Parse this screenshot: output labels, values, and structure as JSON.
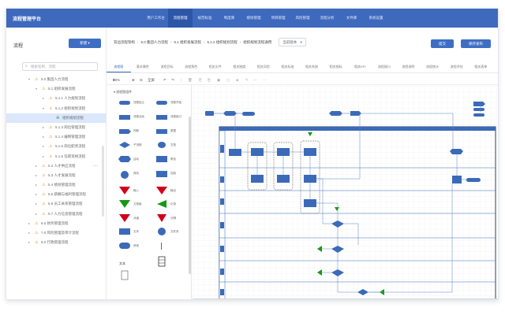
{
  "app": {
    "title": "流程管理平台"
  },
  "topnav": {
    "items": [
      "用户工作台",
      "流程管理",
      "规范标准",
      "制度库",
      "绩效管理",
      "项目管理",
      "风险管理",
      "流程分析",
      "文件库",
      "系统设置"
    ],
    "active_index": 1
  },
  "sidebar": {
    "title": "流程",
    "new_button": "新建",
    "search_placeholder": "搜索名称、流程",
    "tree": [
      {
        "label": "5.0 集团人力流程",
        "level": 1,
        "expanded": true
      },
      {
        "label": "5.1 组织发展流程",
        "level": 2,
        "expanded": true
      },
      {
        "label": "5.1.1 人力规划流程",
        "level": 3
      },
      {
        "label": "5.1.2 组织规划流程",
        "level": 3,
        "expanded": true
      },
      {
        "label": "组织规划流程",
        "level": 4,
        "selected": true
      },
      {
        "label": "5.1.3 岗位管理流程",
        "level": 3
      },
      {
        "label": "5.1.4 编制管理流程",
        "level": 3
      },
      {
        "label": "5.1.5 岗位职责流程",
        "level": 3
      },
      {
        "label": "5.1.6 任职资格流程",
        "level": 3
      },
      {
        "label": "5.2 人才供应流程",
        "level": 2
      },
      {
        "label": "5.3 人才发展流程",
        "level": 2
      },
      {
        "label": "5.4 绩效管理流程",
        "level": 2
      },
      {
        "label": "5.5 薪酬与福利管理流程",
        "level": 2
      },
      {
        "label": "5.6 员工关系管理流程",
        "level": 2
      },
      {
        "label": "5.7 人力信息管理流程",
        "level": 2
      },
      {
        "label": "6.0 财务管理流程",
        "level": 1
      },
      {
        "label": "7.0 风险管理及审计流程",
        "level": 1
      },
      {
        "label": "8.0 行政管理流程",
        "level": 1
      }
    ]
  },
  "breadcrumb": {
    "items": [
      "双边流程架构",
      "5.0 集团人力流程",
      "5.1 组织发展流程",
      "5.1.2 组织规划流程",
      "组织规划流程通用"
    ],
    "version": "当前版本"
  },
  "actions": {
    "primary": "提交",
    "secondary": "保存发布"
  },
  "tabs": [
    "流程图",
    "基本属性",
    "流程目标",
    "流程角色",
    "相关文件",
    "相关制度",
    "相关风险",
    "相关标准",
    "相关系统",
    "相关指标",
    "相关KPI",
    "流程接口",
    "流程说明",
    "流程统计",
    "流程评估",
    "相关表单"
  ],
  "toolbar": {
    "zoom": "35%",
    "zoom_in": "+",
    "zoom_out": "−",
    "fit": "全屏"
  },
  "palette": {
    "title": "流程图组件",
    "items": [
      "流程起止",
      "流程开始",
      "流程活动",
      "流程接口",
      "判断",
      "数据",
      "子流程",
      "文档",
      "活动",
      "角色",
      "风险",
      "控制",
      "输入",
      "输出",
      "文档组",
      "记录",
      "泳道",
      "分隔",
      "文本",
      "文件夹",
      "其他"
    ]
  },
  "colors": {
    "topbar": "#3e69bd",
    "accent": "#3e6ec4",
    "node": "#3b6ab8",
    "warn": "#d0021b",
    "ok": "#169a14",
    "lane": "#3b6ab8"
  }
}
